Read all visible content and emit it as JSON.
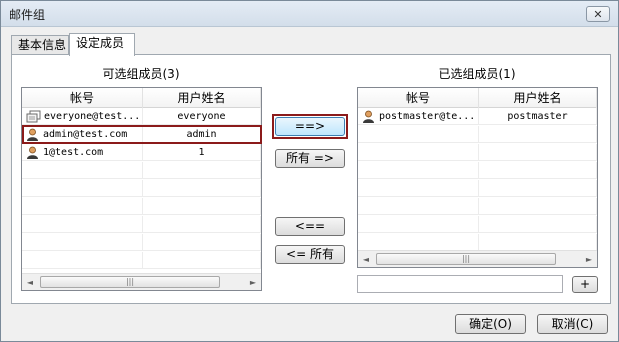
{
  "window": {
    "title": "邮件组",
    "close_label": "✕"
  },
  "tabs": [
    {
      "label": "基本信息"
    },
    {
      "label": "设定成员"
    }
  ],
  "available": {
    "label": "可选组成员(3)",
    "columns": [
      "帐号",
      "用户姓名"
    ],
    "rows": [
      {
        "account": "everyone@test...",
        "name": "everyone",
        "icon": "group-icon"
      },
      {
        "account": "admin@test.com",
        "name": "admin",
        "icon": "user-icon"
      },
      {
        "account": "1@test.com",
        "name": "1",
        "icon": "user-icon"
      }
    ]
  },
  "selected": {
    "label": "已选组成员(1)",
    "columns": [
      "帐号",
      "用户姓名"
    ],
    "rows": [
      {
        "account": "postmaster@te...",
        "name": "postmaster",
        "icon": "user-icon"
      }
    ]
  },
  "transfer": {
    "add_label": "==>",
    "add_all_label": "所有 =>",
    "remove_label": "<==",
    "remove_all_label": "<= 所有"
  },
  "add_input": {
    "value": "",
    "button_label": "+"
  },
  "footer": {
    "ok_label": "确定(O)",
    "cancel_label": "取消(C)"
  },
  "scrollbar": {
    "left": "◄",
    "right": "►",
    "grip": "|||"
  }
}
